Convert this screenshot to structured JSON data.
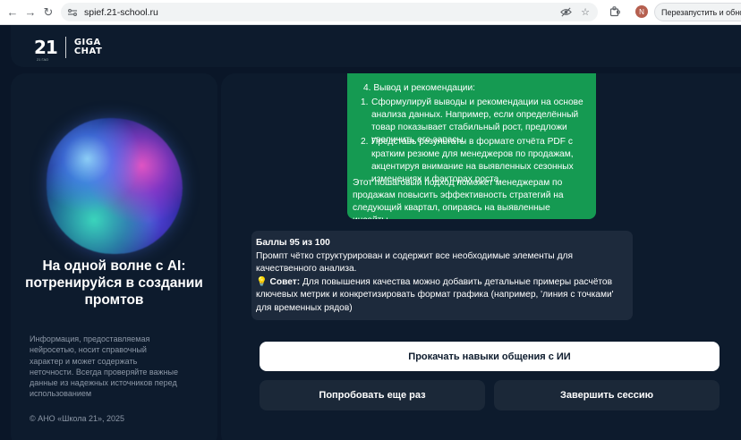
{
  "browser": {
    "url": "spief.21-school.ru",
    "relaunch_label": "Перезапустить и обнов",
    "avatar_letter": "N"
  },
  "header": {
    "logo_21": "21",
    "logo_sub": "21 ГАО",
    "logo_giga_1": "GIGA",
    "logo_giga_2": "CHAT"
  },
  "left": {
    "title": "На одной волне с AI: потренируйся в создании промтов",
    "info": "Информация, предоставляемая нейросетью, носит справочный характер и может содержать неточности. Всегда проверяйте важные данные из надежных источников перед использованием",
    "copyright": "© АНО «Школа 21», 2025"
  },
  "chat": {
    "green": {
      "section": "4. Вывод и рекомендации:",
      "item1": "Сформулируй выводы и рекомендации на основе анализа данных. Например, если определённый товар показывает стабильный рост, предложи увеличить его запасы.",
      "item2": "Представь результаты в формате отчёта PDF с кратким резюме для менеджеров по продажам, акцентируя внимание на выявленных сезонных изменениях и факторах роста.",
      "footer": "Этот пошаговый подход поможет менеджерам по продажам повысить эффективность стратегий на следующий квартал, опираясь на выявленные инсайты."
    },
    "score": {
      "title": "Баллы 95 из 100",
      "text": "Промпт чётко структурирован и содержит все необходимые элементы для качественного анализа.",
      "tip_label": "Совет:",
      "tip_text": "Для повышения качества можно добавить детальные примеры расчётов ключевых метрик и конкретизировать формат графика (например, 'линия с точками' для временных рядов)"
    }
  },
  "buttons": {
    "primary": "Прокачать навыки общения с ИИ",
    "retry": "Попробовать еще раз",
    "end": "Завершить сессию"
  }
}
